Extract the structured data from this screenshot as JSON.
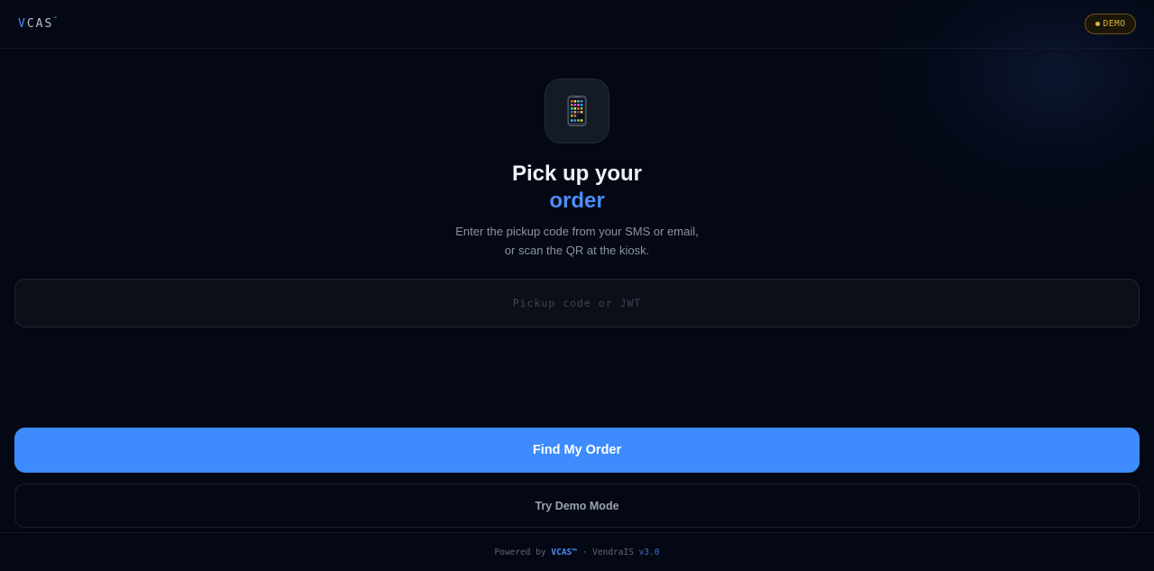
{
  "header": {
    "logo_v": "V",
    "logo_rest": "CAS",
    "logo_tm": "™",
    "badge_label": "DEMO"
  },
  "hero": {
    "icon": "mobile-phone-icon",
    "title_line1": "Pick up your",
    "title_line2": "order",
    "subtitle_line1": "Enter the pickup code from your SMS or email,",
    "subtitle_line2": "or scan the QR at the kiosk."
  },
  "form": {
    "code_value": "",
    "code_placeholder": "Pickup code or JWT",
    "primary_label": "Find My Order",
    "secondary_label": "Try Demo Mode"
  },
  "footer": {
    "powered_by": "Powered by ",
    "brand": "VCAS™",
    "separator": " · ",
    "company": "VendraIS ",
    "version": "v3.0"
  },
  "colors": {
    "accent": "#3d8bfd",
    "background": "#040814",
    "demo_badge": "#e2b23f"
  }
}
